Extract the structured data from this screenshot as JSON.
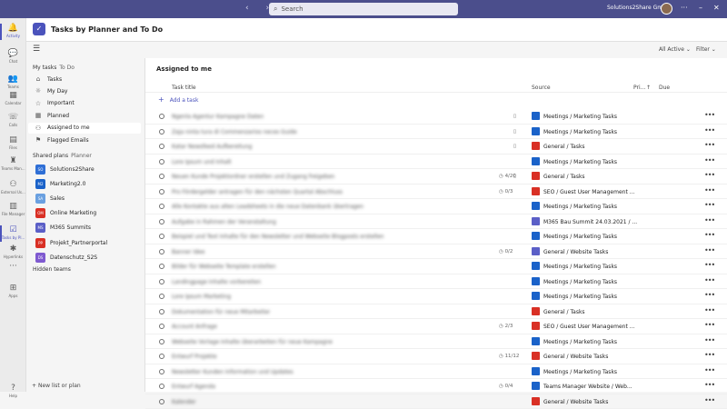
{
  "titlebar": {
    "search_placeholder": "Search",
    "org_name": "Solutions2Share GmbH"
  },
  "rail": {
    "items": [
      {
        "label": "Activity",
        "icon": "bell-icon"
      },
      {
        "label": "Chat",
        "icon": "chat-icon"
      },
      {
        "label": "Teams",
        "icon": "teams-icon"
      },
      {
        "label": "Calendar",
        "icon": "calendar-icon"
      },
      {
        "label": "Calls",
        "icon": "phone-icon"
      },
      {
        "label": "Files",
        "icon": "files-icon"
      },
      {
        "label": "Teams Man...",
        "icon": "teams-manager-icon"
      },
      {
        "label": "External Us...",
        "icon": "external-user-icon"
      },
      {
        "label": "File Manager",
        "icon": "file-manager-icon"
      },
      {
        "label": "Tasks by Pl...",
        "icon": "tasks-icon"
      },
      {
        "label": "Hyperlinks",
        "icon": "hyperlinks-icon"
      },
      {
        "label": "...",
        "icon": "more-icon"
      },
      {
        "label": "Apps",
        "icon": "apps-icon"
      },
      {
        "label": "Help",
        "icon": "help-icon"
      }
    ]
  },
  "app": {
    "title": "Tasks by Planner and To Do"
  },
  "toolbar": {
    "all_active": "All Active",
    "filter": "Filter"
  },
  "left": {
    "my_tasks_label": "My tasks",
    "my_tasks_sub": "To Do",
    "nav": [
      "Tasks",
      "My Day",
      "Important",
      "Planned",
      "Assigned to me",
      "Flagged Emails"
    ],
    "shared_label": "Shared plans",
    "shared_sub": "Planner",
    "plans": [
      {
        "name": "Solutions2Share",
        "abbr": "SO",
        "color": "#2f6fd6"
      },
      {
        "name": "Marketing2.0",
        "abbr": "M2",
        "color": "#1a62c9"
      },
      {
        "name": "Sales",
        "abbr": "SA",
        "color": "#6aa0e0"
      },
      {
        "name": "Online Marketing",
        "abbr": "OM",
        "color": "#d93025"
      },
      {
        "name": "M365 Summits",
        "abbr": "MS",
        "color": "#5b5fc7"
      },
      {
        "name": "Projekt_Partnerportal",
        "abbr": "PP",
        "color": "#d93025"
      },
      {
        "name": "Datenschutz_S2S",
        "abbr": "DS",
        "color": "#7f5ad0"
      }
    ],
    "hidden_teams": "Hidden teams",
    "new_list": "New list or plan"
  },
  "main": {
    "title": "Assigned to me",
    "columns": {
      "task": "Task title",
      "source": "Source",
      "priority": "Pri...",
      "due": "Due"
    },
    "add_task": "Add a task",
    "tasks": [
      {
        "title": "Ngenla Agentur Kampagne Daten",
        "meta": "",
        "source": "Meetings / Marketing Tasks",
        "color": "#1a62c9"
      },
      {
        "title": "Zaja ninta tura di Commenzarios neces Guide",
        "meta": "",
        "source": "Meetings / Marketing Tasks",
        "color": "#1a62c9"
      },
      {
        "title": "Katar Newsfeed Aufbereitung",
        "meta": "",
        "source": "General / Tasks",
        "color": "#d93025"
      },
      {
        "title": "Lore Ipsum und Inhalt",
        "meta": "",
        "source": "Meetings / Marketing Tasks",
        "color": "#1a62c9"
      },
      {
        "title": "Neuen Kunde Projektordner erstellen und Zugang freigeben",
        "meta": "4/20",
        "source": "General / Tasks",
        "color": "#d93025"
      },
      {
        "title": "Pro Fördergelder antragen für den nächsten Quartal Abschluss",
        "meta": "0/3",
        "source": "SEO / Guest User Management ...",
        "color": "#d93025"
      },
      {
        "title": "Alle Kontakte aus alten Leadsheets in die neue Datenbank übertragen",
        "meta": "",
        "source": "Meetings / Marketing Tasks",
        "color": "#1a62c9"
      },
      {
        "title": "Aufgabe in Rahmen der Veranstaltung",
        "meta": "",
        "source": "M365 Bau Summit 24.03.2021 / ...",
        "color": "#5b5fc7"
      },
      {
        "title": "Beispiel und Text Inhalte für den Newsletter und Webseite Blogposts erstellen",
        "meta": "",
        "source": "Meetings / Marketing Tasks",
        "color": "#1a62c9"
      },
      {
        "title": "Banner Idee",
        "meta": "0/2",
        "source": "General / Website Tasks",
        "color": "#5b5fc7"
      },
      {
        "title": "Bilder für Webseite Template erstellen",
        "meta": "",
        "source": "Meetings / Marketing Tasks",
        "color": "#1a62c9"
      },
      {
        "title": "Landingpage Inhalte vorbereiten",
        "meta": "",
        "source": "Meetings / Marketing Tasks",
        "color": "#1a62c9"
      },
      {
        "title": "Lore Ipsum Marketing",
        "meta": "",
        "source": "Meetings / Marketing Tasks",
        "color": "#1a62c9"
      },
      {
        "title": "Dokumentation für neue Mitarbeiter",
        "meta": "",
        "source": "General / Tasks",
        "color": "#d93025"
      },
      {
        "title": "Account Anfrage",
        "meta": "2/3",
        "source": "SEO / Guest User Management ...",
        "color": "#d93025"
      },
      {
        "title": "Webseite Vorlage Inhalte überarbeiten für neue Kampagne",
        "meta": "",
        "source": "Meetings / Marketing Tasks",
        "color": "#1a62c9"
      },
      {
        "title": "Entwurf Projekte",
        "meta": "11/12",
        "source": "General / Website Tasks",
        "color": "#d93025"
      },
      {
        "title": "Newsletter Kunden Information und Updates",
        "meta": "",
        "source": "Meetings / Marketing Tasks",
        "color": "#1a62c9"
      },
      {
        "title": "Entwurf Agenda",
        "meta": "0/4",
        "source": "Teams Manager Website / Web...",
        "color": "#1a62c9"
      },
      {
        "title": "Kalender",
        "meta": "",
        "source": "General / Website Tasks",
        "color": "#d93025"
      }
    ]
  }
}
